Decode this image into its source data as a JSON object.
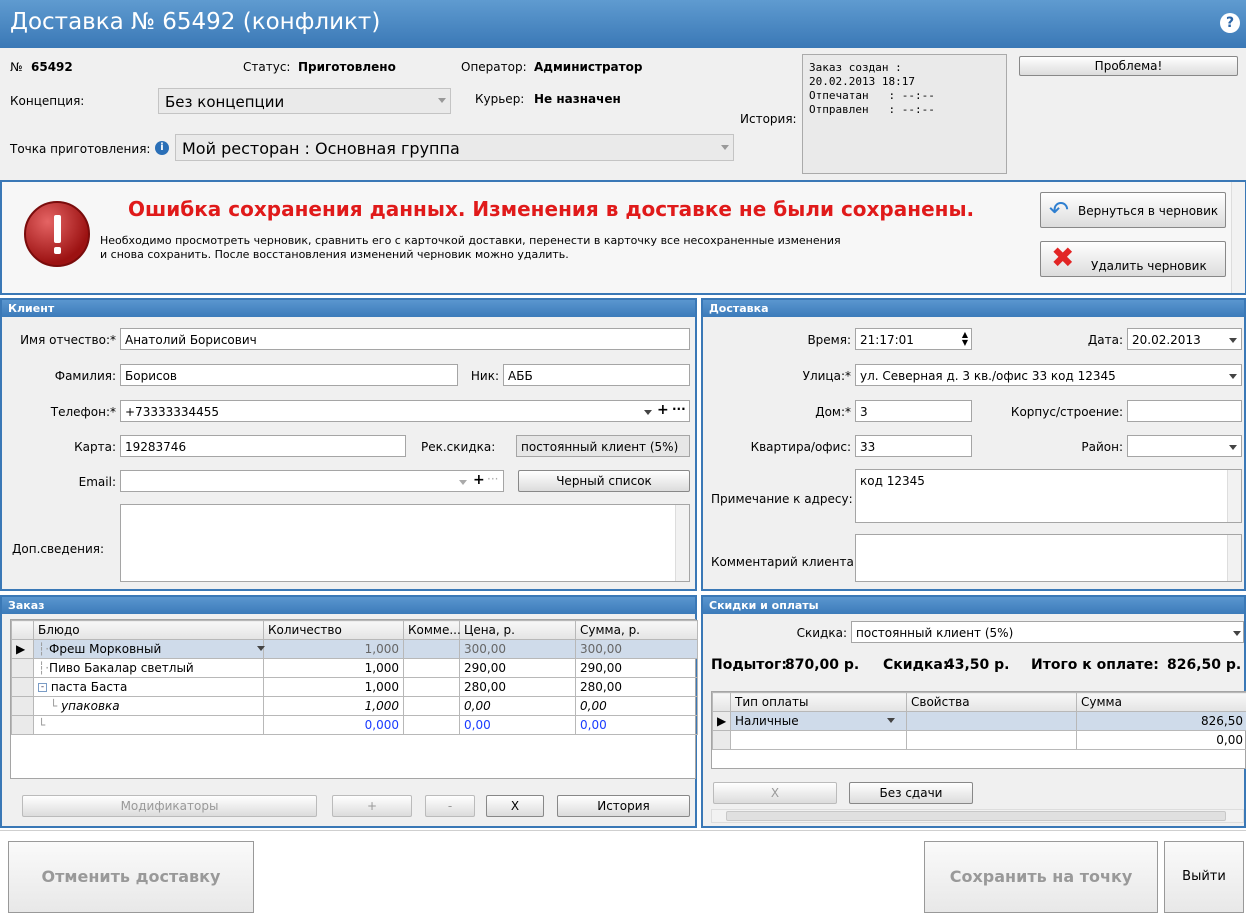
{
  "window": {
    "title": "Доставка № 65492 (конфликт)",
    "help": "?"
  },
  "header": {
    "number_label": "№",
    "number": "65492",
    "status_label": "Статус:",
    "status": "Приготовлено",
    "operator_label": "Оператор:",
    "operator": "Администратор",
    "concept_label": "Концепция:",
    "concept": "Без концепции",
    "courier_label": "Курьер:",
    "courier": "Не назначен",
    "point_label": "Точка приготовления:",
    "point": "Мой ресторан : Основная группа",
    "history_label": "История:",
    "history_text": "Заказ создан :\n20.02.2013 18:17\nОтпечатан   : --:--\nОтправлен   : --:--",
    "problem_button": "Проблема!"
  },
  "error": {
    "title": "Ошибка сохранения данных. Изменения в доставке не были сохранены.",
    "line1": "Необходимо просмотреть черновик, сравнить его с карточкой доставки, перенести в карточку все несохраненные изменения",
    "line2": "и снова сохранить.  После восстановления изменений черновик можно удалить.",
    "back_button": "Вернуться в черновик",
    "delete_button": "Удалить черновик"
  },
  "client": {
    "header": "Клиент",
    "name_label": "Имя отчество:*",
    "name": "Анатолий Борисович",
    "surname_label": "Фамилия:",
    "surname": "Борисов",
    "nick_label": "Ник:",
    "nick": "АББ",
    "phone_label": "Телефон:*",
    "phone": "+73333334455",
    "card_label": "Карта:",
    "card": "19283746",
    "discount_label": "Рек.скидка:",
    "discount": "постоянный клиент (5%)",
    "email_label": "Email:",
    "email": "",
    "blacklist_button": "Черный список",
    "extra_label": "Доп.сведения:",
    "extra": ""
  },
  "delivery": {
    "header": "Доставка",
    "time_label": "Время:",
    "time": "21:17:01",
    "date_label": "Дата:",
    "date": "20.02.2013",
    "street_label": "Улица:*",
    "street": "ул. Северная д. 3 кв./офис 33 код 12345",
    "house_label": "Дом:*",
    "house": "3",
    "building_label": "Корпус/строение:",
    "building": "",
    "apartment_label": "Квартира/офис:",
    "apartment": "33",
    "district_label": "Район:",
    "district": "",
    "address_note_label": "Примечание к адресу:",
    "address_note": "код 12345",
    "client_comment_label": "Комментарий клиента:",
    "client_comment": ""
  },
  "order": {
    "header": "Заказ",
    "columns": [
      "Блюдо",
      "Количество",
      "Комме...",
      "Цена, р.",
      "Сумма, р."
    ],
    "rows": [
      [
        "Фреш Морковный",
        "1,000",
        "",
        "300,00",
        "300,00"
      ],
      [
        "Пиво Бакалар светлый",
        "1,000",
        "",
        "290,00",
        "290,00"
      ],
      [
        "паста Баста",
        "1,000",
        "",
        "280,00",
        "280,00"
      ],
      [
        "упаковка",
        "1,000",
        "",
        "0,00",
        "0,00"
      ],
      [
        "",
        "0,000",
        "",
        "0,00",
        "0,00"
      ]
    ],
    "buttons": {
      "modifiers": "Модификаторы",
      "plus": "+",
      "minus": "-",
      "x": "X",
      "history": "История"
    }
  },
  "payments": {
    "header": "Скидки и оплаты",
    "discount_label": "Скидка:",
    "discount": "постоянный клиент (5%)",
    "subtotal_label": "Подытог:",
    "subtotal": "870,00 р.",
    "disc_label": "Скидка:",
    "disc": "43,50 р.",
    "total_label": "Итого к оплате:",
    "total": "826,50 р.",
    "columns": [
      "Тип оплаты",
      "Свойства",
      "Сумма"
    ],
    "rows": [
      [
        "Наличные",
        "",
        "826,50"
      ],
      [
        "",
        "",
        "0,00"
      ]
    ],
    "x_button": "X",
    "no_change_button": "Без сдачи"
  },
  "footer": {
    "cancel_button": "Отменить доставку",
    "save_button": "Сохранить на точку",
    "exit_button": "Выйти"
  }
}
